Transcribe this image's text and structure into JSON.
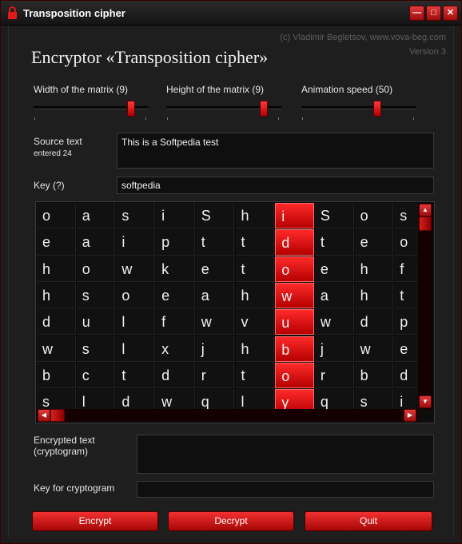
{
  "window": {
    "title": "Transposition cipher"
  },
  "header": {
    "copyright": "(c) Vladimir Begletsov, www.vova-beg.com",
    "version": "Version 3",
    "app_title": "Encryptor «Transposition cipher»"
  },
  "sliders": {
    "width": {
      "label": "Width of the matrix (9)",
      "level": 0.9
    },
    "height": {
      "label": "Height of the matrix (9)",
      "level": 0.9
    },
    "speed": {
      "label": "Animation speed (50)",
      "level": 0.7
    }
  },
  "source": {
    "label": "Source text",
    "sublabel": "entered 24",
    "value": "This is a Softpedia test"
  },
  "key": {
    "label": "Key (?)",
    "value": "softpedia"
  },
  "matrix": {
    "highlight_column": 6,
    "rows": [
      [
        "o",
        "a",
        "s",
        "i",
        "S",
        "h",
        "i",
        "S",
        "o",
        "s"
      ],
      [
        "e",
        "a",
        "i",
        "p",
        "t",
        "t",
        "d",
        "t",
        "e",
        "o"
      ],
      [
        "h",
        "o",
        "w",
        "k",
        "e",
        "t",
        "o",
        "e",
        "h",
        "f"
      ],
      [
        "h",
        "s",
        "o",
        "e",
        "a",
        "h",
        "w",
        "a",
        "h",
        "t"
      ],
      [
        "d",
        "u",
        "l",
        "f",
        "w",
        "v",
        "u",
        "w",
        "d",
        "p"
      ],
      [
        "w",
        "s",
        "l",
        "x",
        "j",
        "h",
        "b",
        "j",
        "w",
        "e"
      ],
      [
        "b",
        "c",
        "t",
        "d",
        "r",
        "t",
        "o",
        "r",
        "b",
        "d"
      ],
      [
        "s",
        "l",
        "d",
        "w",
        "q",
        "l",
        "y",
        "q",
        "s",
        "i"
      ]
    ]
  },
  "encrypted": {
    "label": "Encrypted text\n(cryptogram)",
    "value": ""
  },
  "crypto_key": {
    "label": "Key for cryptogram",
    "value": ""
  },
  "buttons": {
    "encrypt": "Encrypt",
    "decrypt": "Decrypt",
    "quit": "Quit"
  },
  "colors": {
    "accent": "#e01a1a",
    "background": "#1e1e1e"
  }
}
